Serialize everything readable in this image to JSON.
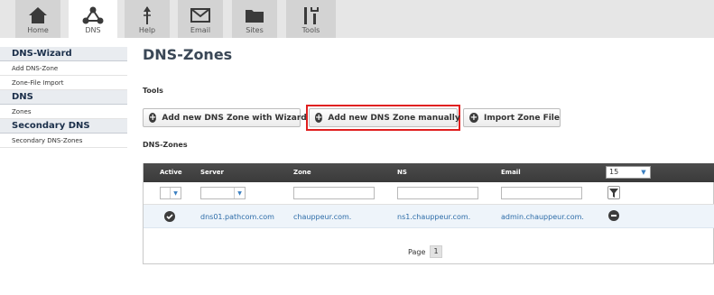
{
  "nav": {
    "tabs": [
      {
        "label": "Home",
        "icon": "home-icon"
      },
      {
        "label": "DNS",
        "icon": "dns-network-icon",
        "active": true
      },
      {
        "label": "Help",
        "icon": "help-icon"
      },
      {
        "label": "Email",
        "icon": "email-icon"
      },
      {
        "label": "Sites",
        "icon": "sites-folder-icon"
      },
      {
        "label": "Tools",
        "icon": "tools-icon"
      }
    ]
  },
  "sidebar": {
    "sections": [
      {
        "title": "DNS-Wizard",
        "items": [
          "Add DNS-Zone",
          "Zone-File Import"
        ]
      },
      {
        "title": "DNS",
        "items": [
          "Zones"
        ]
      },
      {
        "title": "Secondary DNS",
        "items": [
          "Secondary DNS-Zones"
        ]
      }
    ]
  },
  "main": {
    "title": "DNS-Zones",
    "tools_label": "Tools",
    "buttons": {
      "wizard": "Add new DNS Zone with Wizard",
      "manual": "Add new DNS Zone manually",
      "import": "Import Zone File"
    },
    "table_label": "DNS-Zones",
    "table": {
      "columns": [
        "Active",
        "Server",
        "Zone",
        "NS",
        "Email"
      ],
      "per_page": "15",
      "rows": [
        {
          "active": true,
          "server": "dns01.pathcom.com",
          "zone": "chauppeur.com.",
          "ns": "ns1.chauppeur.com.",
          "email": "admin.chauppeur.com."
        }
      ],
      "pager_label": "Page",
      "current_page": "1"
    }
  },
  "colors": {
    "highlight": "#e02020",
    "link": "#2d6ca8",
    "header_bg": "#3a3a3a",
    "sidebar_head_bg": "#e9ecf0"
  }
}
